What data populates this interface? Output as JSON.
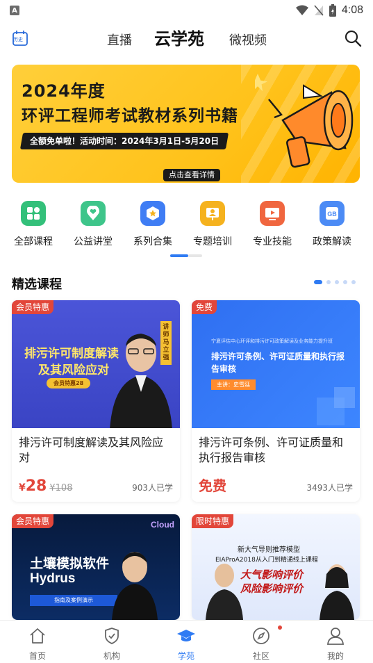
{
  "status_bar": {
    "time": "4:08"
  },
  "header": {
    "history_label": "历史",
    "tab_live": "直播",
    "title": "云学苑",
    "tab_short_video": "微视频"
  },
  "banner": {
    "line1": "2024年度",
    "line2": "环评工程师考试教材系列书籍",
    "pill": "全额免单啦！活动时间：2024年3月1日-5月20日",
    "cta": "点击查看详情"
  },
  "categories": [
    {
      "label": "全部课程",
      "icon": "grid-icon",
      "color": "#33c07a"
    },
    {
      "label": "公益讲堂",
      "icon": "location-heart-icon",
      "color": "#3ec58a"
    },
    {
      "label": "系列合集",
      "icon": "star-badge-icon",
      "color": "#3f7df4"
    },
    {
      "label": "专题培训",
      "icon": "trainer-icon",
      "color": "#f5b21e"
    },
    {
      "label": "专业技能",
      "icon": "video-play-icon",
      "color": "#f0663f"
    },
    {
      "label": "政策解读",
      "icon": "gb-doc-icon",
      "color": "#4c8bf5"
    }
  ],
  "section": {
    "title": "精选课程"
  },
  "courses": [
    {
      "badge": "会员特惠",
      "thumb_title_1": "排污许可制度解读",
      "thumb_title_2": "及其风险应对",
      "thumb_tag": "会员特惠28",
      "thumb_lecturer": "讲师 马立强",
      "title": "排污许可制度解读及其风险应对",
      "price_symbol": "¥",
      "price": "28",
      "price_old": "¥108",
      "learners": "903人已学"
    },
    {
      "badge": "免费",
      "thumb_small": "宁夏评估中心环评和排污许可政策解读及业务能力提升班",
      "thumb_title_1": "排污许可条例、许可证质量和执行报",
      "thumb_title_2": "告审核",
      "thumb_lecturer": "主讲：史雪廷",
      "title": "排污许可条例、许可证质量和执行报告审核",
      "price_free": "免费",
      "learners": "3493人已学"
    },
    {
      "badge": "会员特惠",
      "thumb_brand": "Cloud",
      "thumb_title_1": "土壤模拟软件",
      "thumb_title_2": "Hydrus",
      "thumb_tag": "指南及案例演示"
    },
    {
      "badge": "限时特惠",
      "thumb_small": "新大气导则推荐模型",
      "thumb_small_2": "EIAProA2018从入门到精通线上课程",
      "thumb_title_1": "大气影响评价",
      "thumb_title_2": "风险影响评价"
    }
  ],
  "bottom_nav": [
    {
      "label": "首页",
      "icon": "home-icon"
    },
    {
      "label": "机构",
      "icon": "shield-check-icon"
    },
    {
      "label": "学苑",
      "icon": "graduation-cap-icon",
      "active": true
    },
    {
      "label": "社区",
      "icon": "compass-icon"
    },
    {
      "label": "我的",
      "icon": "person-icon"
    }
  ],
  "colors": {
    "accent": "#2f7bf3",
    "price_red": "#e2463a",
    "banner_yellow": "#ffc21a"
  }
}
